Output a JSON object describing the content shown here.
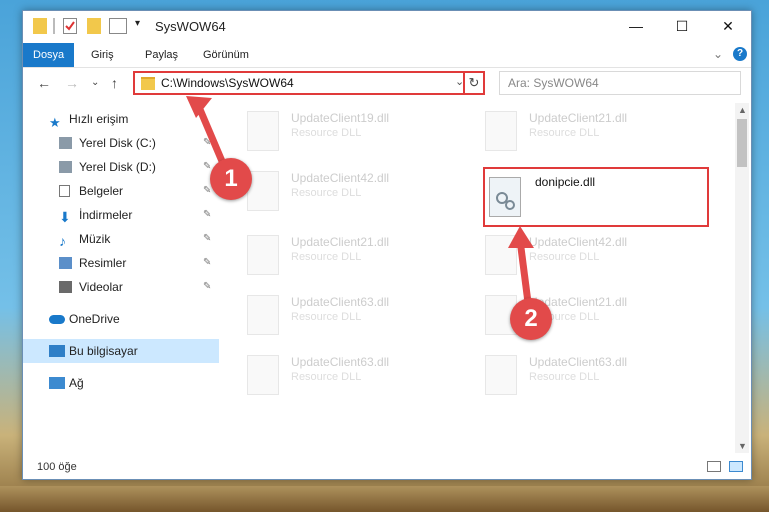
{
  "window": {
    "title": "SysWOW64",
    "minimize_glyph": "—",
    "maximize_glyph": "☐",
    "close_glyph": "✕"
  },
  "ribbon": {
    "tabs": [
      {
        "label": "Dosya",
        "active": true
      },
      {
        "label": "Giriş",
        "active": false
      },
      {
        "label": "Paylaş",
        "active": false
      },
      {
        "label": "Görünüm",
        "active": false
      }
    ],
    "expand_glyph": "⌄",
    "help_glyph": "?"
  },
  "nav": {
    "back_glyph": "←",
    "forward_glyph": "→",
    "recent_glyph": "⌄",
    "up_glyph": "↑",
    "address": "C:\\Windows\\SysWOW64",
    "address_dropdown_glyph": "⌄",
    "refresh_glyph": "↻",
    "search_placeholder": "Ara: SysWOW64"
  },
  "sidebar": {
    "items": [
      {
        "label": "Hızlı erişim",
        "icon": "star-icon",
        "pinned": false
      },
      {
        "label": "Yerel Disk (C:)",
        "icon": "drive-icon",
        "pinned": true
      },
      {
        "label": "Yerel Disk (D:)",
        "icon": "drive-icon",
        "pinned": true
      },
      {
        "label": "Belgeler",
        "icon": "documents-icon",
        "pinned": true
      },
      {
        "label": "İndirmeler",
        "icon": "download-icon",
        "pinned": true
      },
      {
        "label": "Müzik",
        "icon": "music-icon",
        "pinned": true
      },
      {
        "label": "Resimler",
        "icon": "pictures-icon",
        "pinned": true
      },
      {
        "label": "Videolar",
        "icon": "videos-icon",
        "pinned": true
      },
      {
        "label": "OneDrive",
        "icon": "cloud-icon",
        "pinned": false
      },
      {
        "label": "Bu bilgisayar",
        "icon": "computer-icon",
        "pinned": false,
        "selected": true
      },
      {
        "label": "Ağ",
        "icon": "network-icon",
        "pinned": false
      }
    ],
    "pin_glyph": "📌"
  },
  "files": [
    {
      "name": "UpdateClient19.dll",
      "type": "Resource DLL"
    },
    {
      "name": "UpdateClient21.dll",
      "type": "Resource DLL"
    },
    {
      "name": "UpdateClient42.dll",
      "type": "Resource DLL"
    },
    {
      "name": "donipcie.dll",
      "type": "",
      "highlighted": true
    },
    {
      "name": "UpdateClient21.dll",
      "type": "Resource DLL"
    },
    {
      "name": "UpdateClient42.dll",
      "type": "Resource DLL"
    },
    {
      "name": "UpdateClient63.dll",
      "type": "Resource DLL"
    },
    {
      "name": "UpdateClient21.dll",
      "type": "Resource DLL"
    },
    {
      "name": "UpdateClient63.dll",
      "type": "Resource DLL"
    },
    {
      "name": "UpdateClient63.dll",
      "type": "Resource DLL"
    }
  ],
  "status": {
    "item_count": "100 öğe"
  },
  "callouts": {
    "first": "1",
    "second": "2"
  },
  "colors": {
    "accent": "#1979ca",
    "highlight": "#e03a3a",
    "callout": "#e24a4a",
    "selected": "#cce8ff"
  }
}
